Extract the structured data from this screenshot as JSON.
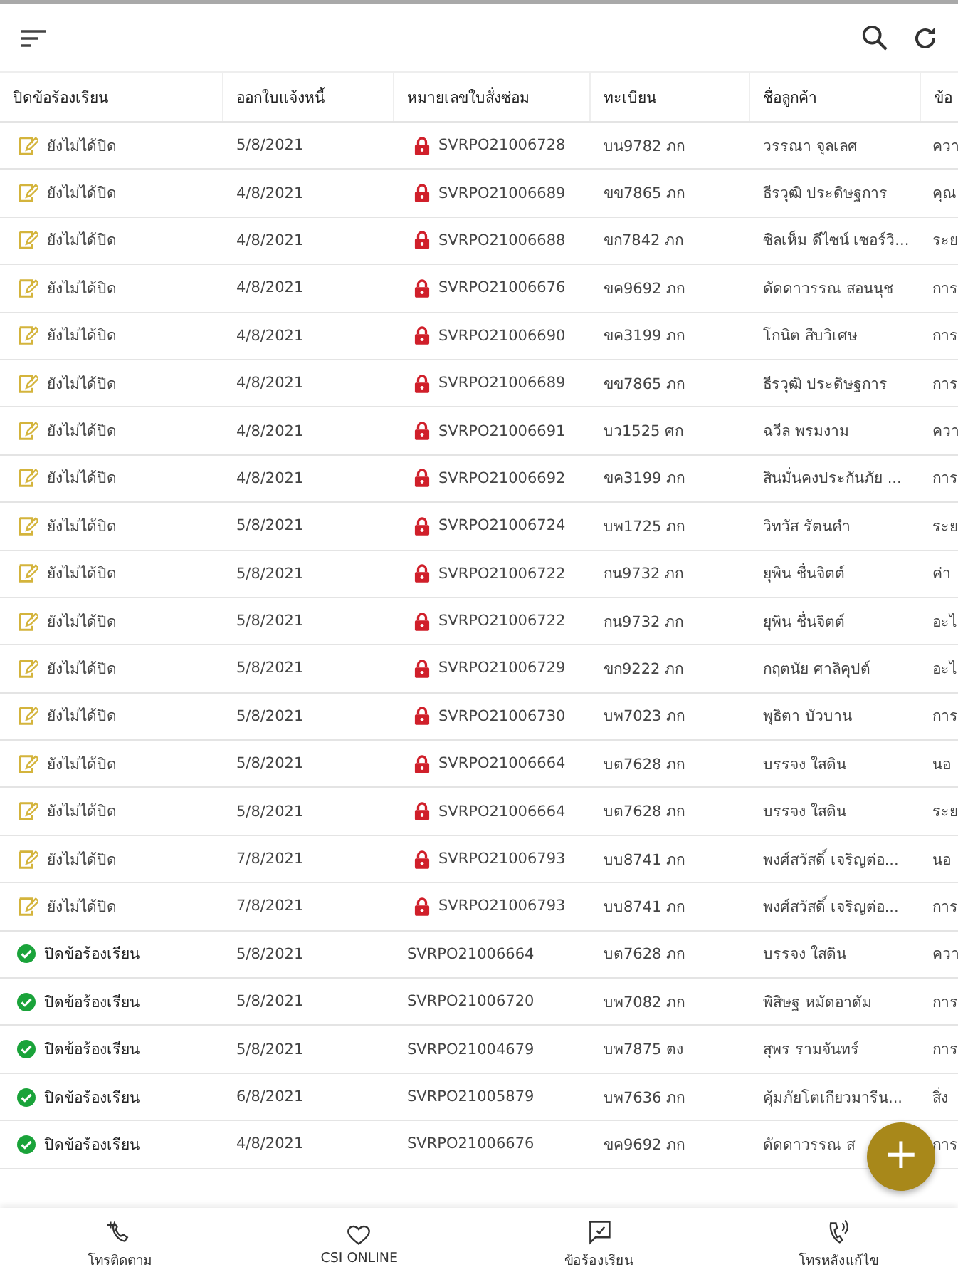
{
  "table": {
    "columns": [
      "ปิดข้อร้องเรียน",
      "ออกใบแจ้งหนี้",
      "หมายเลขใบสั่งซ่อม",
      "ทะเบียน",
      "ชื่อลูกค้า",
      "ข้อ"
    ],
    "rows": [
      {
        "kind": "open",
        "status": "ยังไม่ได้ปิด",
        "invoice_date": "5/8/2021",
        "order_no": "SVRPO21006728",
        "locked": true,
        "plate": "บน9782 ภก",
        "customer": "วรรณา จุลเลศ",
        "column_6": "ควา"
      },
      {
        "kind": "open",
        "status": "ยังไม่ได้ปิด",
        "invoice_date": "4/8/2021",
        "order_no": "SVRPO21006689",
        "locked": true,
        "plate": "ขข7865 ภก",
        "customer": "ธีรวุฒิ ประดิษฐการ",
        "column_6": "คุณ"
      },
      {
        "kind": "open",
        "status": "ยังไม่ได้ปิด",
        "invoice_date": "4/8/2021",
        "order_no": "SVRPO21006688",
        "locked": true,
        "plate": "ขก7842 ภก",
        "customer": "ซิลเห็ม ดีไซน์ เซอร์วิ...",
        "column_6": "ระย"
      },
      {
        "kind": "open",
        "status": "ยังไม่ได้ปิด",
        "invoice_date": "4/8/2021",
        "order_no": "SVRPO21006676",
        "locked": true,
        "plate": "ขค9692 ภก",
        "customer": "ดัดดาวรรณ สอนนุช",
        "column_6": "การ"
      },
      {
        "kind": "open",
        "status": "ยังไม่ได้ปิด",
        "invoice_date": "4/8/2021",
        "order_no": "SVRPO21006690",
        "locked": true,
        "plate": "ขค3199 ภก",
        "customer": "โกนิต สืบวิเศษ",
        "column_6": "การ"
      },
      {
        "kind": "open",
        "status": "ยังไม่ได้ปิด",
        "invoice_date": "4/8/2021",
        "order_no": "SVRPO21006689",
        "locked": true,
        "plate": "ขข7865 ภก",
        "customer": "ธีรวุฒิ ประดิษฐการ",
        "column_6": "การ"
      },
      {
        "kind": "open",
        "status": "ยังไม่ได้ปิด",
        "invoice_date": "4/8/2021",
        "order_no": "SVRPO21006691",
        "locked": true,
        "plate": "บว1525 ศก",
        "customer": "ฉวีล พรมงาม",
        "column_6": "ควา"
      },
      {
        "kind": "open",
        "status": "ยังไม่ได้ปิด",
        "invoice_date": "4/8/2021",
        "order_no": "SVRPO21006692",
        "locked": true,
        "plate": "ขค3199 ภก",
        "customer": "สินมั่นคงประกันภัย ...",
        "column_6": "การ"
      },
      {
        "kind": "open",
        "status": "ยังไม่ได้ปิด",
        "invoice_date": "5/8/2021",
        "order_no": "SVRPO21006724",
        "locked": true,
        "plate": "บพ1725 ภก",
        "customer": "วิทวัส รัตนคำ",
        "column_6": "ระย"
      },
      {
        "kind": "open",
        "status": "ยังไม่ได้ปิด",
        "invoice_date": "5/8/2021",
        "order_no": "SVRPO21006722",
        "locked": true,
        "plate": "กน9732 ภก",
        "customer": "ยุพิน ชื่นจิตต์",
        "column_6": "ค่า"
      },
      {
        "kind": "open",
        "status": "ยังไม่ได้ปิด",
        "invoice_date": "5/8/2021",
        "order_no": "SVRPO21006722",
        "locked": true,
        "plate": "กน9732 ภก",
        "customer": "ยุพิน ชื่นจิตต์",
        "column_6": "อะไ"
      },
      {
        "kind": "open",
        "status": "ยังไม่ได้ปิด",
        "invoice_date": "5/8/2021",
        "order_no": "SVRPO21006729",
        "locked": true,
        "plate": "ขก9222 ภก",
        "customer": "กฤตนัย ศาลิคุปต์",
        "column_6": "อะไ"
      },
      {
        "kind": "open",
        "status": "ยังไม่ได้ปิด",
        "invoice_date": "5/8/2021",
        "order_no": "SVRPO21006730",
        "locked": true,
        "plate": "บพ7023 ภก",
        "customer": "พุธิตา บัวบาน",
        "column_6": "การ"
      },
      {
        "kind": "open",
        "status": "ยังไม่ได้ปิด",
        "invoice_date": "5/8/2021",
        "order_no": "SVRPO21006664",
        "locked": true,
        "plate": "บต7628 ภก",
        "customer": "บรรจง ใสดิน",
        "column_6": "นอ"
      },
      {
        "kind": "open",
        "status": "ยังไม่ได้ปิด",
        "invoice_date": "5/8/2021",
        "order_no": "SVRPO21006664",
        "locked": true,
        "plate": "บต7628 ภก",
        "customer": "บรรจง ใสดิน",
        "column_6": "ระย"
      },
      {
        "kind": "open",
        "status": "ยังไม่ได้ปิด",
        "invoice_date": "7/8/2021",
        "order_no": "SVRPO21006793",
        "locked": true,
        "plate": "บบ8741 ภก",
        "customer": "พงศ์สวัสดิ์ เจริญต่อ...",
        "column_6": "นอ"
      },
      {
        "kind": "open",
        "status": "ยังไม่ได้ปิด",
        "invoice_date": "7/8/2021",
        "order_no": "SVRPO21006793",
        "locked": true,
        "plate": "บบ8741 ภก",
        "customer": "พงศ์สวัสดิ์ เจริญต่อ...",
        "column_6": "การ"
      },
      {
        "kind": "closed",
        "status": "ปิดข้อร้องเรียน",
        "invoice_date": "5/8/2021",
        "order_no": "SVRPO21006664",
        "locked": false,
        "plate": "บต7628 ภก",
        "customer": "บรรจง ใสดิน",
        "column_6": "ควา"
      },
      {
        "kind": "closed",
        "status": "ปิดข้อร้องเรียน",
        "invoice_date": "5/8/2021",
        "order_no": "SVRPO21006720",
        "locked": false,
        "plate": "บพ7082 ภก",
        "customer": "พิสิษฐ หมัดอาดัม",
        "column_6": "การ"
      },
      {
        "kind": "closed",
        "status": "ปิดข้อร้องเรียน",
        "invoice_date": "5/8/2021",
        "order_no": "SVRPO21004679",
        "locked": false,
        "plate": "บพ7875 ตง",
        "customer": "สุพร รามจันทร์",
        "column_6": "การ"
      },
      {
        "kind": "closed",
        "status": "ปิดข้อร้องเรียน",
        "invoice_date": "6/8/2021",
        "order_no": "SVRPO21005879",
        "locked": false,
        "plate": "บพ7636 ภก",
        "customer": "คุ้มภัยโตเกียวมารีน...",
        "column_6": "สิ่ง"
      },
      {
        "kind": "closed",
        "status": "ปิดข้อร้องเรียน",
        "invoice_date": "4/8/2021",
        "order_no": "SVRPO21006676",
        "locked": false,
        "plate": "ขค9692 ภก",
        "customer": "ดัดดาวรรณ ส",
        "column_6": "การ"
      }
    ]
  },
  "fab": {
    "label": "+"
  },
  "bottom_nav": [
    {
      "kind": "call",
      "label": "โทรติดตาม"
    },
    {
      "kind": "heart",
      "label": "CSI ONLINE"
    },
    {
      "kind": "chat",
      "label": "ข้อร้องเรียน"
    },
    {
      "kind": "phone",
      "label": "โทรหลังแก้ไข"
    }
  ]
}
